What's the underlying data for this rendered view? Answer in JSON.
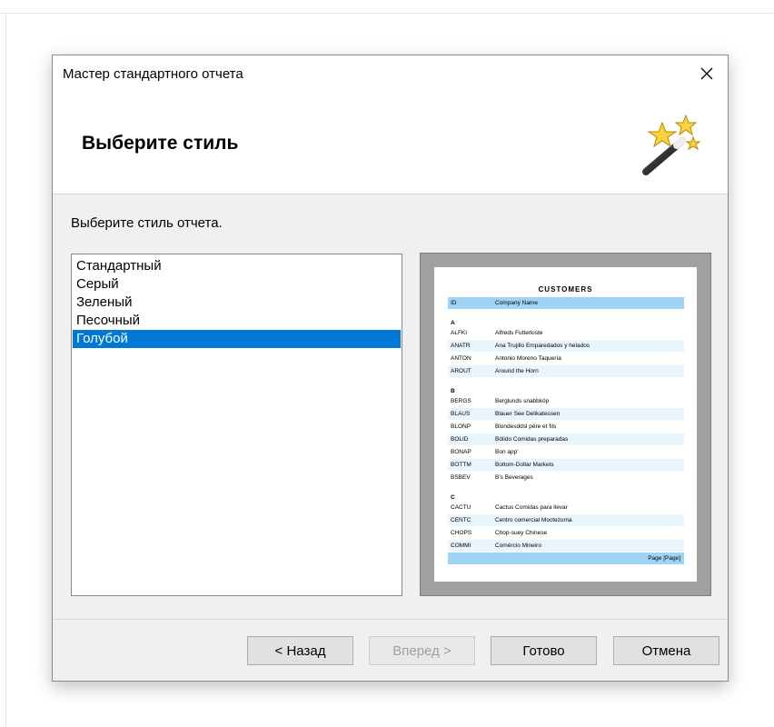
{
  "window": {
    "title": "Мастер стандартного отчета"
  },
  "header": {
    "title": "Выберите стиль"
  },
  "instruction": "Выберите стиль отчета.",
  "styles": [
    {
      "label": "Стандартный"
    },
    {
      "label": "Серый"
    },
    {
      "label": "Зеленый"
    },
    {
      "label": "Песочный"
    },
    {
      "label": "Голубой",
      "selected": true
    }
  ],
  "preview": {
    "title": "CUSTOMERS",
    "column_headers": [
      "ID",
      "Company Name"
    ],
    "groups": [
      {
        "letter": "A",
        "rows": [
          [
            "ALFKI",
            "Alfreds Futterkiste"
          ],
          [
            "ANATR",
            "Ana Trujillo Emparedados y helados"
          ],
          [
            "ANTON",
            "Antonio Moreno Taquería"
          ],
          [
            "AROUT",
            "Around the Horn"
          ]
        ]
      },
      {
        "letter": "B",
        "rows": [
          [
            "BERGS",
            "Berglunds snabbköp"
          ],
          [
            "BLAUS",
            "Blauer See Delikatessen"
          ],
          [
            "BLONP",
            "Blondesddsl père et fils"
          ],
          [
            "BOLID",
            "Bólido Comidas preparadas"
          ],
          [
            "BONAP",
            "Bon app'"
          ],
          [
            "BOTTM",
            "Bottom-Dollar Markets"
          ],
          [
            "BSBEV",
            "B's Beverages"
          ]
        ]
      },
      {
        "letter": "C",
        "rows": [
          [
            "CACTU",
            "Cactus Comidas para llevar"
          ],
          [
            "CENTC",
            "Centro comercial Moctezuma"
          ],
          [
            "CHOPS",
            "Chop-suey Chinese"
          ],
          [
            "COMMI",
            "Comércio Mineiro"
          ]
        ]
      }
    ],
    "footer": "Page [Page]",
    "accent_color": "#9fd4f6"
  },
  "buttons": {
    "back": "< Назад",
    "next": "Вперед >",
    "finish": "Готово",
    "cancel": "Отмена"
  },
  "colors": {
    "selection": "#0078d7"
  }
}
